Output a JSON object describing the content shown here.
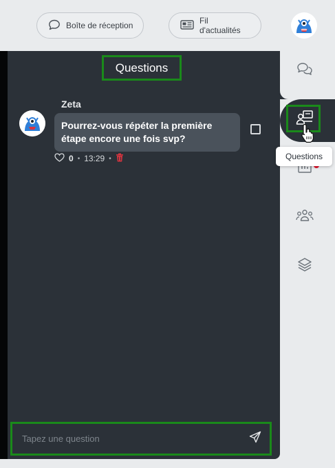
{
  "topbar": {
    "inbox_label": "Boîte de réception",
    "feed_label": "Fil d'actualités"
  },
  "panel": {
    "title": "Questions"
  },
  "question": {
    "author": "Zeta",
    "text": "Pourrez-vous répéter la première étape encore une fois svp?",
    "likes": "0",
    "time": "13:29",
    "separator": "•"
  },
  "composer": {
    "placeholder": "Tapez une question"
  },
  "rail": {
    "items": [
      {
        "icon": "chat-icon"
      },
      {
        "icon": "questions-icon",
        "active": true
      },
      {
        "icon": "poll-chart-icon",
        "badge": true
      },
      {
        "icon": "people-icon"
      },
      {
        "icon": "layers-icon"
      }
    ],
    "tooltip": "Questions"
  },
  "colors": {
    "panel": "#2b3138",
    "bubble": "#4a525b",
    "highlight": "#1a8a1a",
    "badge": "#e0152d",
    "delete": "#d9343f"
  }
}
